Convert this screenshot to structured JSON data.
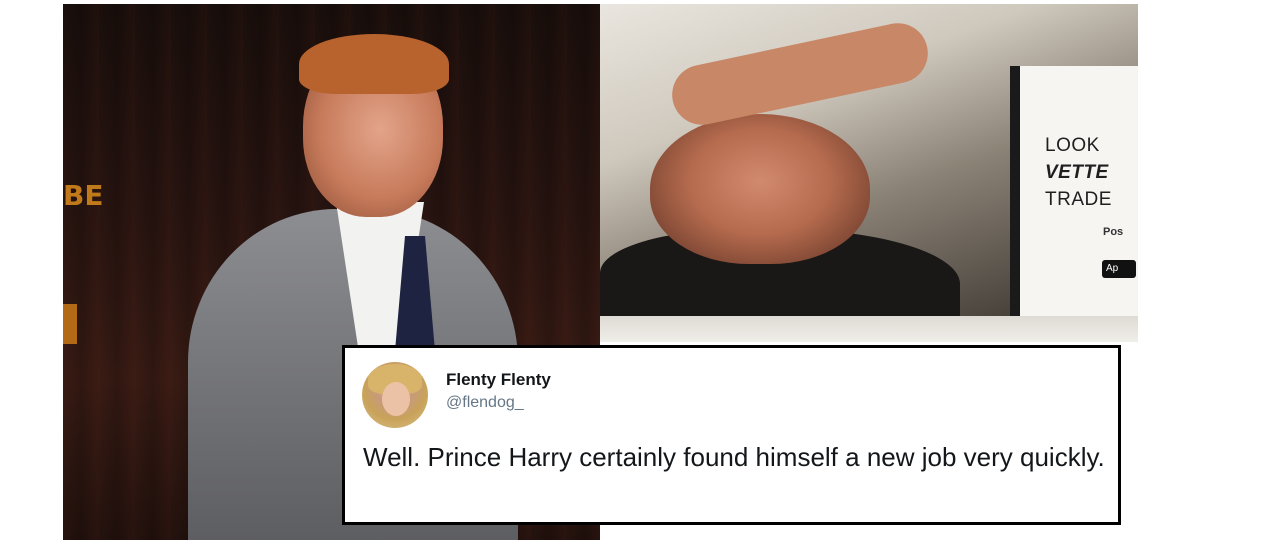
{
  "tweet": {
    "display_name": "Flenty Flenty",
    "handle": "@flendog_",
    "text": "Well. Prince Harry certainly found himself a new job very quickly."
  },
  "right_photo": {
    "board_line1": "LOOK",
    "board_line2": "VETTE",
    "board_line3": "TRADE",
    "board_small": "Pos",
    "badge": "Ap"
  },
  "left_photo": {
    "sign_text": "BE"
  },
  "colors": {
    "tweet_border": "#000000",
    "handle": "#657786",
    "text": "#14171a"
  }
}
